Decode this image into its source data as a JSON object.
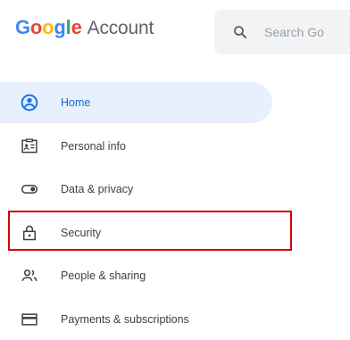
{
  "header": {
    "brand": {
      "logo_letters": [
        {
          "ch": "G",
          "color": "#4285F4"
        },
        {
          "ch": "o",
          "color": "#EA4335"
        },
        {
          "ch": "o",
          "color": "#FBBC05"
        },
        {
          "ch": "g",
          "color": "#4285F4"
        },
        {
          "ch": "l",
          "color": "#34A853"
        },
        {
          "ch": "e",
          "color": "#EA4335"
        }
      ],
      "product": "Account"
    },
    "search": {
      "placeholder": "Search Go",
      "icon": "search-icon"
    }
  },
  "sidebar": {
    "items": [
      {
        "label": "Home",
        "icon": "home-icon",
        "active": true
      },
      {
        "label": "Personal info",
        "icon": "personal-info-icon",
        "active": false
      },
      {
        "label": "Data & privacy",
        "icon": "toggle-icon",
        "active": false
      },
      {
        "label": "Security",
        "icon": "lock-icon",
        "active": false,
        "highlighted": true
      },
      {
        "label": "People & sharing",
        "icon": "people-icon",
        "active": false
      },
      {
        "label": "Payments & subscriptions",
        "icon": "credit-card-icon",
        "active": false
      }
    ]
  },
  "colors": {
    "active_bg": "#e8f0fe",
    "active_text": "#1967d2",
    "highlight_border": "#d50000",
    "icon": "#3c4043"
  }
}
